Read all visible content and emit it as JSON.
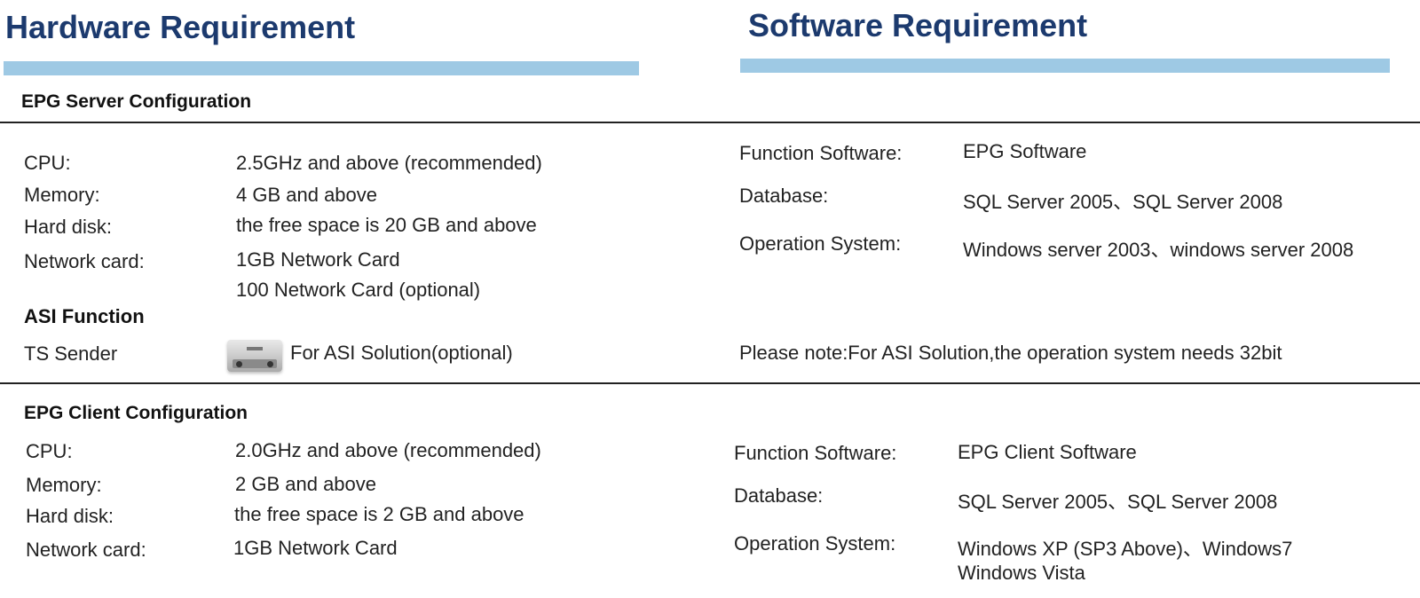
{
  "hardware": {
    "title": "Hardware Requirement",
    "server": {
      "heading": "EPG Server Configuration",
      "rows": [
        {
          "label": "CPU:",
          "value": "2.5GHz and above (recommended)"
        },
        {
          "label": "Memory:",
          "value": "4 GB and above"
        },
        {
          "label": "Hard disk:",
          "value": "the free space is 20 GB and above"
        },
        {
          "label": "Network card:",
          "value": "1GB Network Card",
          "value2": "100 Network Card (optional)"
        }
      ],
      "asi": {
        "heading": "ASI Function",
        "label": "TS Sender",
        "value": "For ASI Solution(optional)",
        "device_icon": "asi-ts-sender-device"
      }
    },
    "client": {
      "heading": "EPG Client Configuration",
      "rows": [
        {
          "label": "CPU:",
          "value": "2.0GHz and above (recommended)"
        },
        {
          "label": "Memory:",
          "value": "2 GB and above"
        },
        {
          "label": "Hard disk:",
          "value": "the free space is 2 GB and above"
        },
        {
          "label": "Network card:",
          "value": "1GB Network Card"
        }
      ]
    }
  },
  "software": {
    "title": "Software Requirement",
    "server": {
      "rows": [
        {
          "label": "Function Software:",
          "value": "EPG Software"
        },
        {
          "label": "Database:",
          "value": "SQL Server 2005、SQL Server 2008"
        },
        {
          "label": "Operation System:",
          "value": "Windows server 2003、windows server 2008"
        }
      ],
      "note": "Please note:For ASI Solution,the operation system needs 32bit"
    },
    "client": {
      "rows": [
        {
          "label": "Function Software:",
          "value": "EPG Client Software"
        },
        {
          "label": "Database:",
          "value": "SQL Server 2005、SQL Server 2008"
        },
        {
          "label": "Operation System:",
          "value": "Windows XP (SP3 Above)、Windows7",
          "value2": "Windows Vista"
        }
      ]
    }
  },
  "colors": {
    "heading": "#1c3a6e",
    "accent_bar": "#9ec9e4",
    "rule": "#222222"
  }
}
